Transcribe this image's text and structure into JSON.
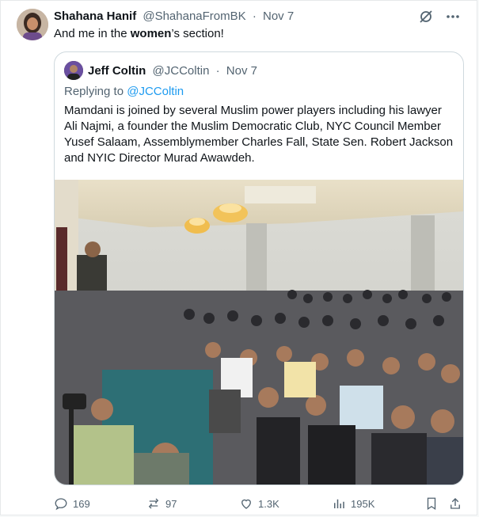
{
  "tweet": {
    "author_name": "Shahana Hanif",
    "author_handle": "@ShahanaFromBK",
    "dot": "·",
    "date": "Nov 7",
    "text_before": "And me in the ",
    "text_bold": "women",
    "text_after": "’s section!"
  },
  "quote": {
    "author_name": "Jeff Coltin",
    "author_handle": "@JCColtin",
    "dot": "·",
    "date": "Nov 7",
    "replying_prefix": "Replying to ",
    "replying_handle": "@JCColtin",
    "text": "Mamdani is joined by several Muslim power players including his lawyer Ali Najmi, a founder the Muslim Democratic Club, NYC Council Member Yusef Salaam, Assemblymember Charles Fall, State Sen. Robert Jackson and NYIC Director Murad Awawdeh."
  },
  "actions": {
    "replies": "169",
    "reposts": "97",
    "likes": "1.3K",
    "views": "195K"
  },
  "icons": {
    "grok": "grok-icon",
    "more": "more-icon",
    "reply": "reply-icon",
    "repost": "repost-icon",
    "like": "like-icon",
    "views": "views-icon",
    "bookmark": "bookmark-icon",
    "share": "share-icon"
  }
}
